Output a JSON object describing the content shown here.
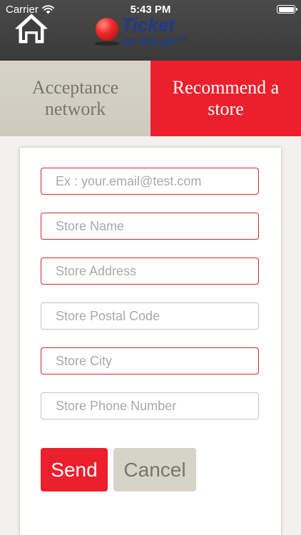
{
  "status_bar": {
    "carrier": "Carrier",
    "time": "5:43 PM",
    "battery_level": 1.0
  },
  "header": {
    "logo": {
      "line1": "Ticket",
      "line2": "on the go™"
    }
  },
  "tabs": [
    {
      "label": "Acceptance network",
      "active": false
    },
    {
      "label": "Recommend a store",
      "active": true
    }
  ],
  "form": {
    "fields": [
      {
        "placeholder": "Ex : your.email@test.com",
        "value": "",
        "state": "error"
      },
      {
        "placeholder": "Store Name",
        "value": "",
        "state": "error"
      },
      {
        "placeholder": "Store Address",
        "value": "",
        "state": "error"
      },
      {
        "placeholder": "Store Postal Code",
        "value": "",
        "state": "normal"
      },
      {
        "placeholder": "Store City",
        "value": "",
        "state": "error"
      },
      {
        "placeholder": "Store Phone Number",
        "value": "",
        "state": "normal"
      }
    ],
    "send_label": "Send",
    "cancel_label": "Cancel"
  },
  "colors": {
    "accent_red": "#ec1f2d",
    "tab_inactive": "#d6d3c9",
    "header_dark": "#3f3f3f",
    "error_border": "#d7262f"
  },
  "icons": {
    "home": "home-icon",
    "wifi": "wifi-icon",
    "battery": "battery-icon"
  }
}
